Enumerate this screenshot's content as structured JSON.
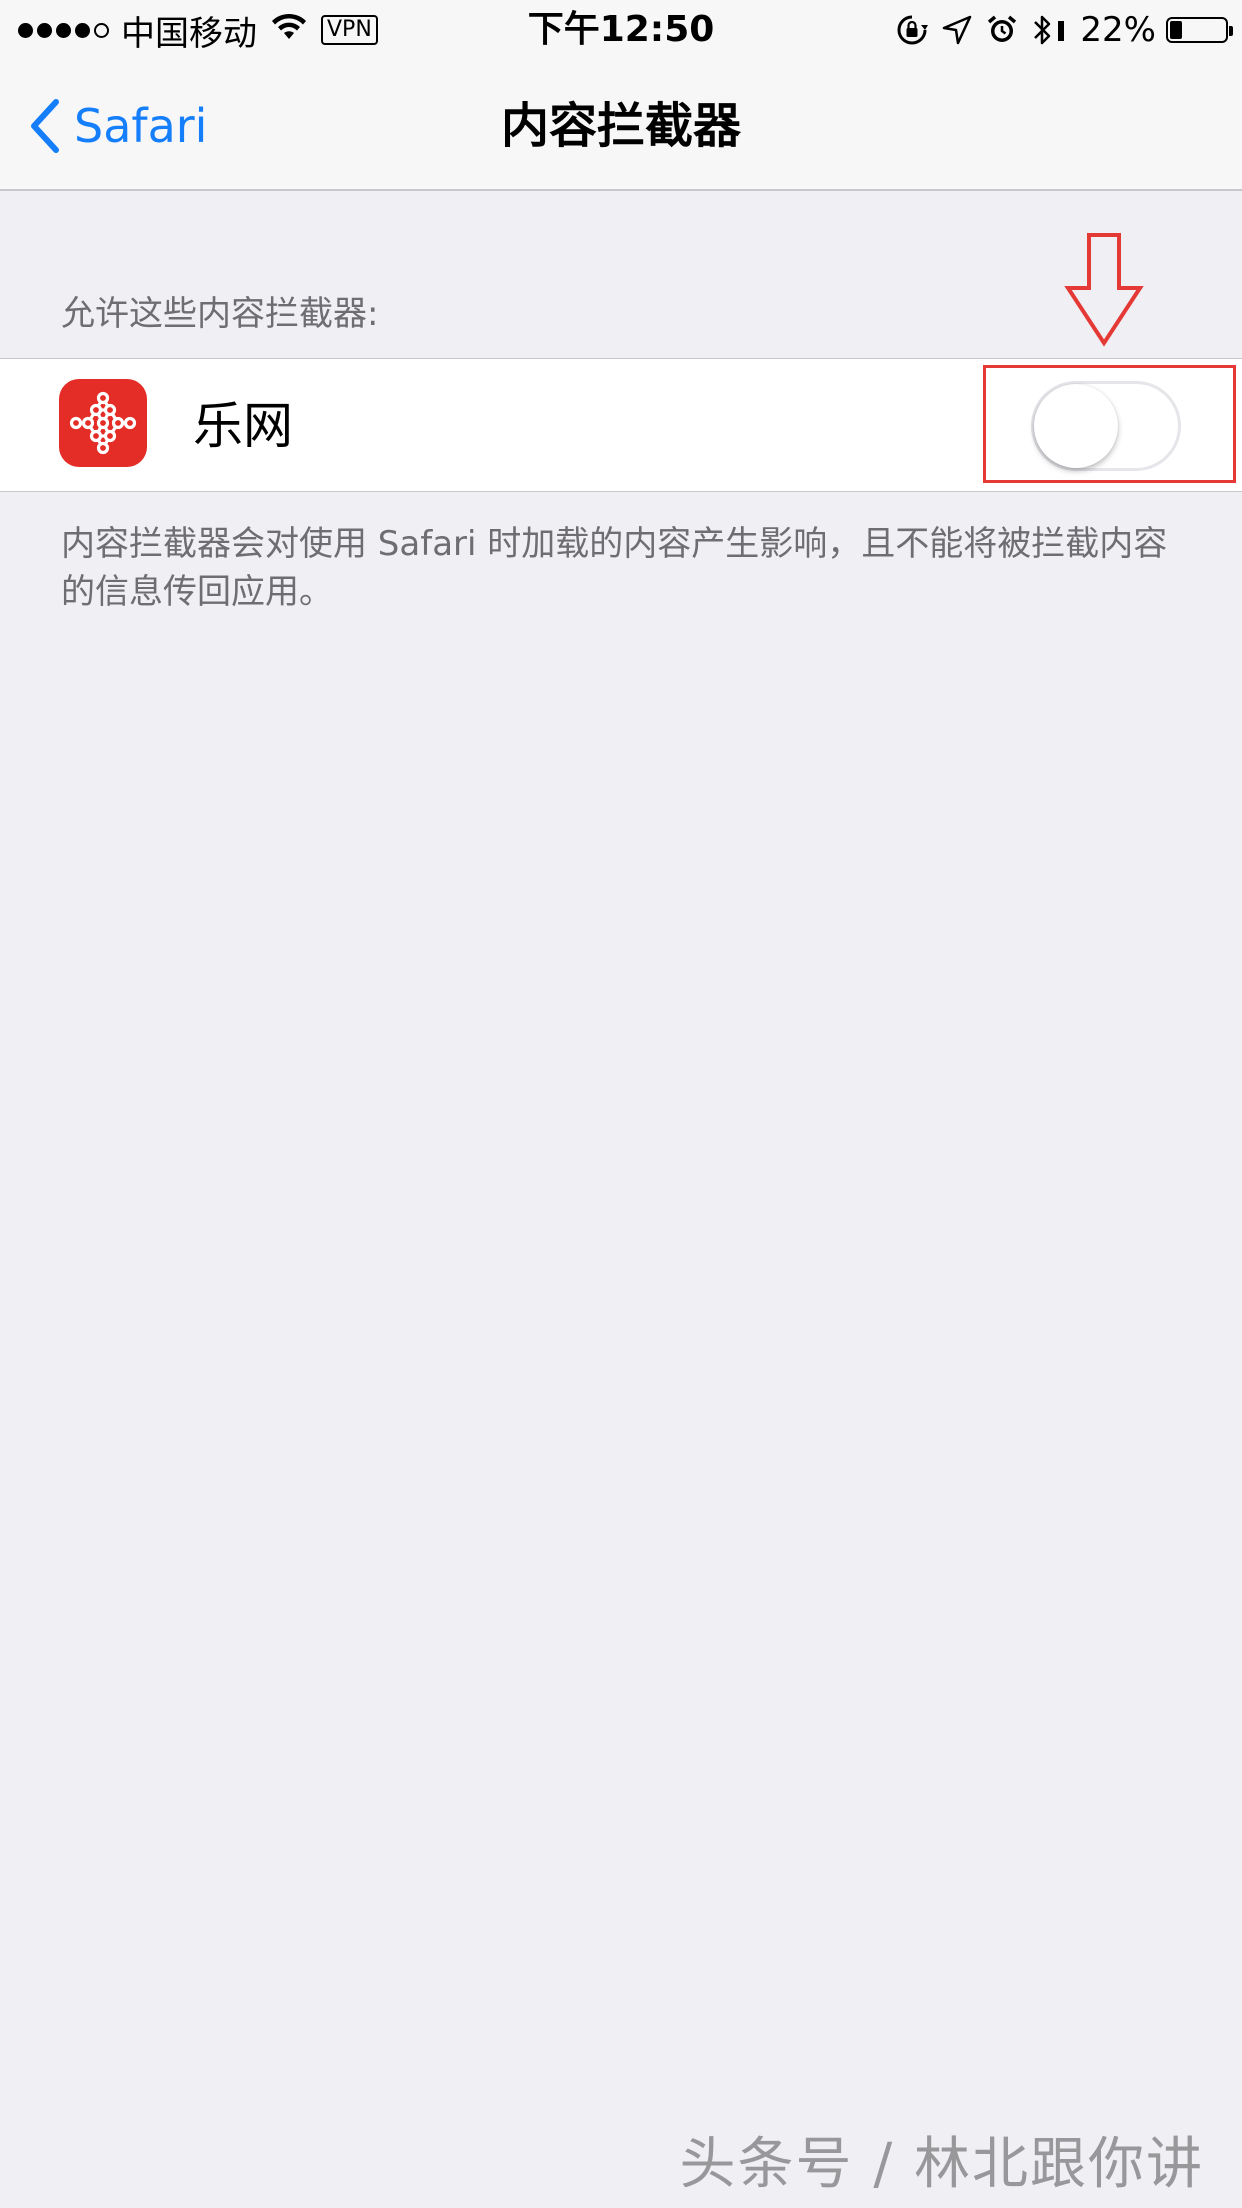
{
  "status_bar": {
    "carrier": "中国移动",
    "vpn": "VPN",
    "time": "下午12:50",
    "battery_percent": "22%",
    "battery_level": 0.22,
    "icons": [
      "signal-icon",
      "wifi-icon",
      "rotation-lock-icon",
      "location-icon",
      "alarm-icon",
      "bluetooth-icon",
      "battery-icon"
    ]
  },
  "nav": {
    "back_label": "Safari",
    "title": "内容拦截器"
  },
  "section": {
    "header": "允许这些内容拦截器:",
    "items": [
      {
        "label": "乐网",
        "icon": "lewang-app-icon",
        "enabled": false
      }
    ],
    "footer": "内容拦截器会对使用 Safari 时加载的内容产生影响，且不能将被拦截内容的信息传回应用。"
  },
  "colors": {
    "accent": "#157efb",
    "background": "#efeff4",
    "app_icon": "#e52d27",
    "annotation": "#e53935"
  },
  "watermark": "头条号 / 林北跟你讲"
}
